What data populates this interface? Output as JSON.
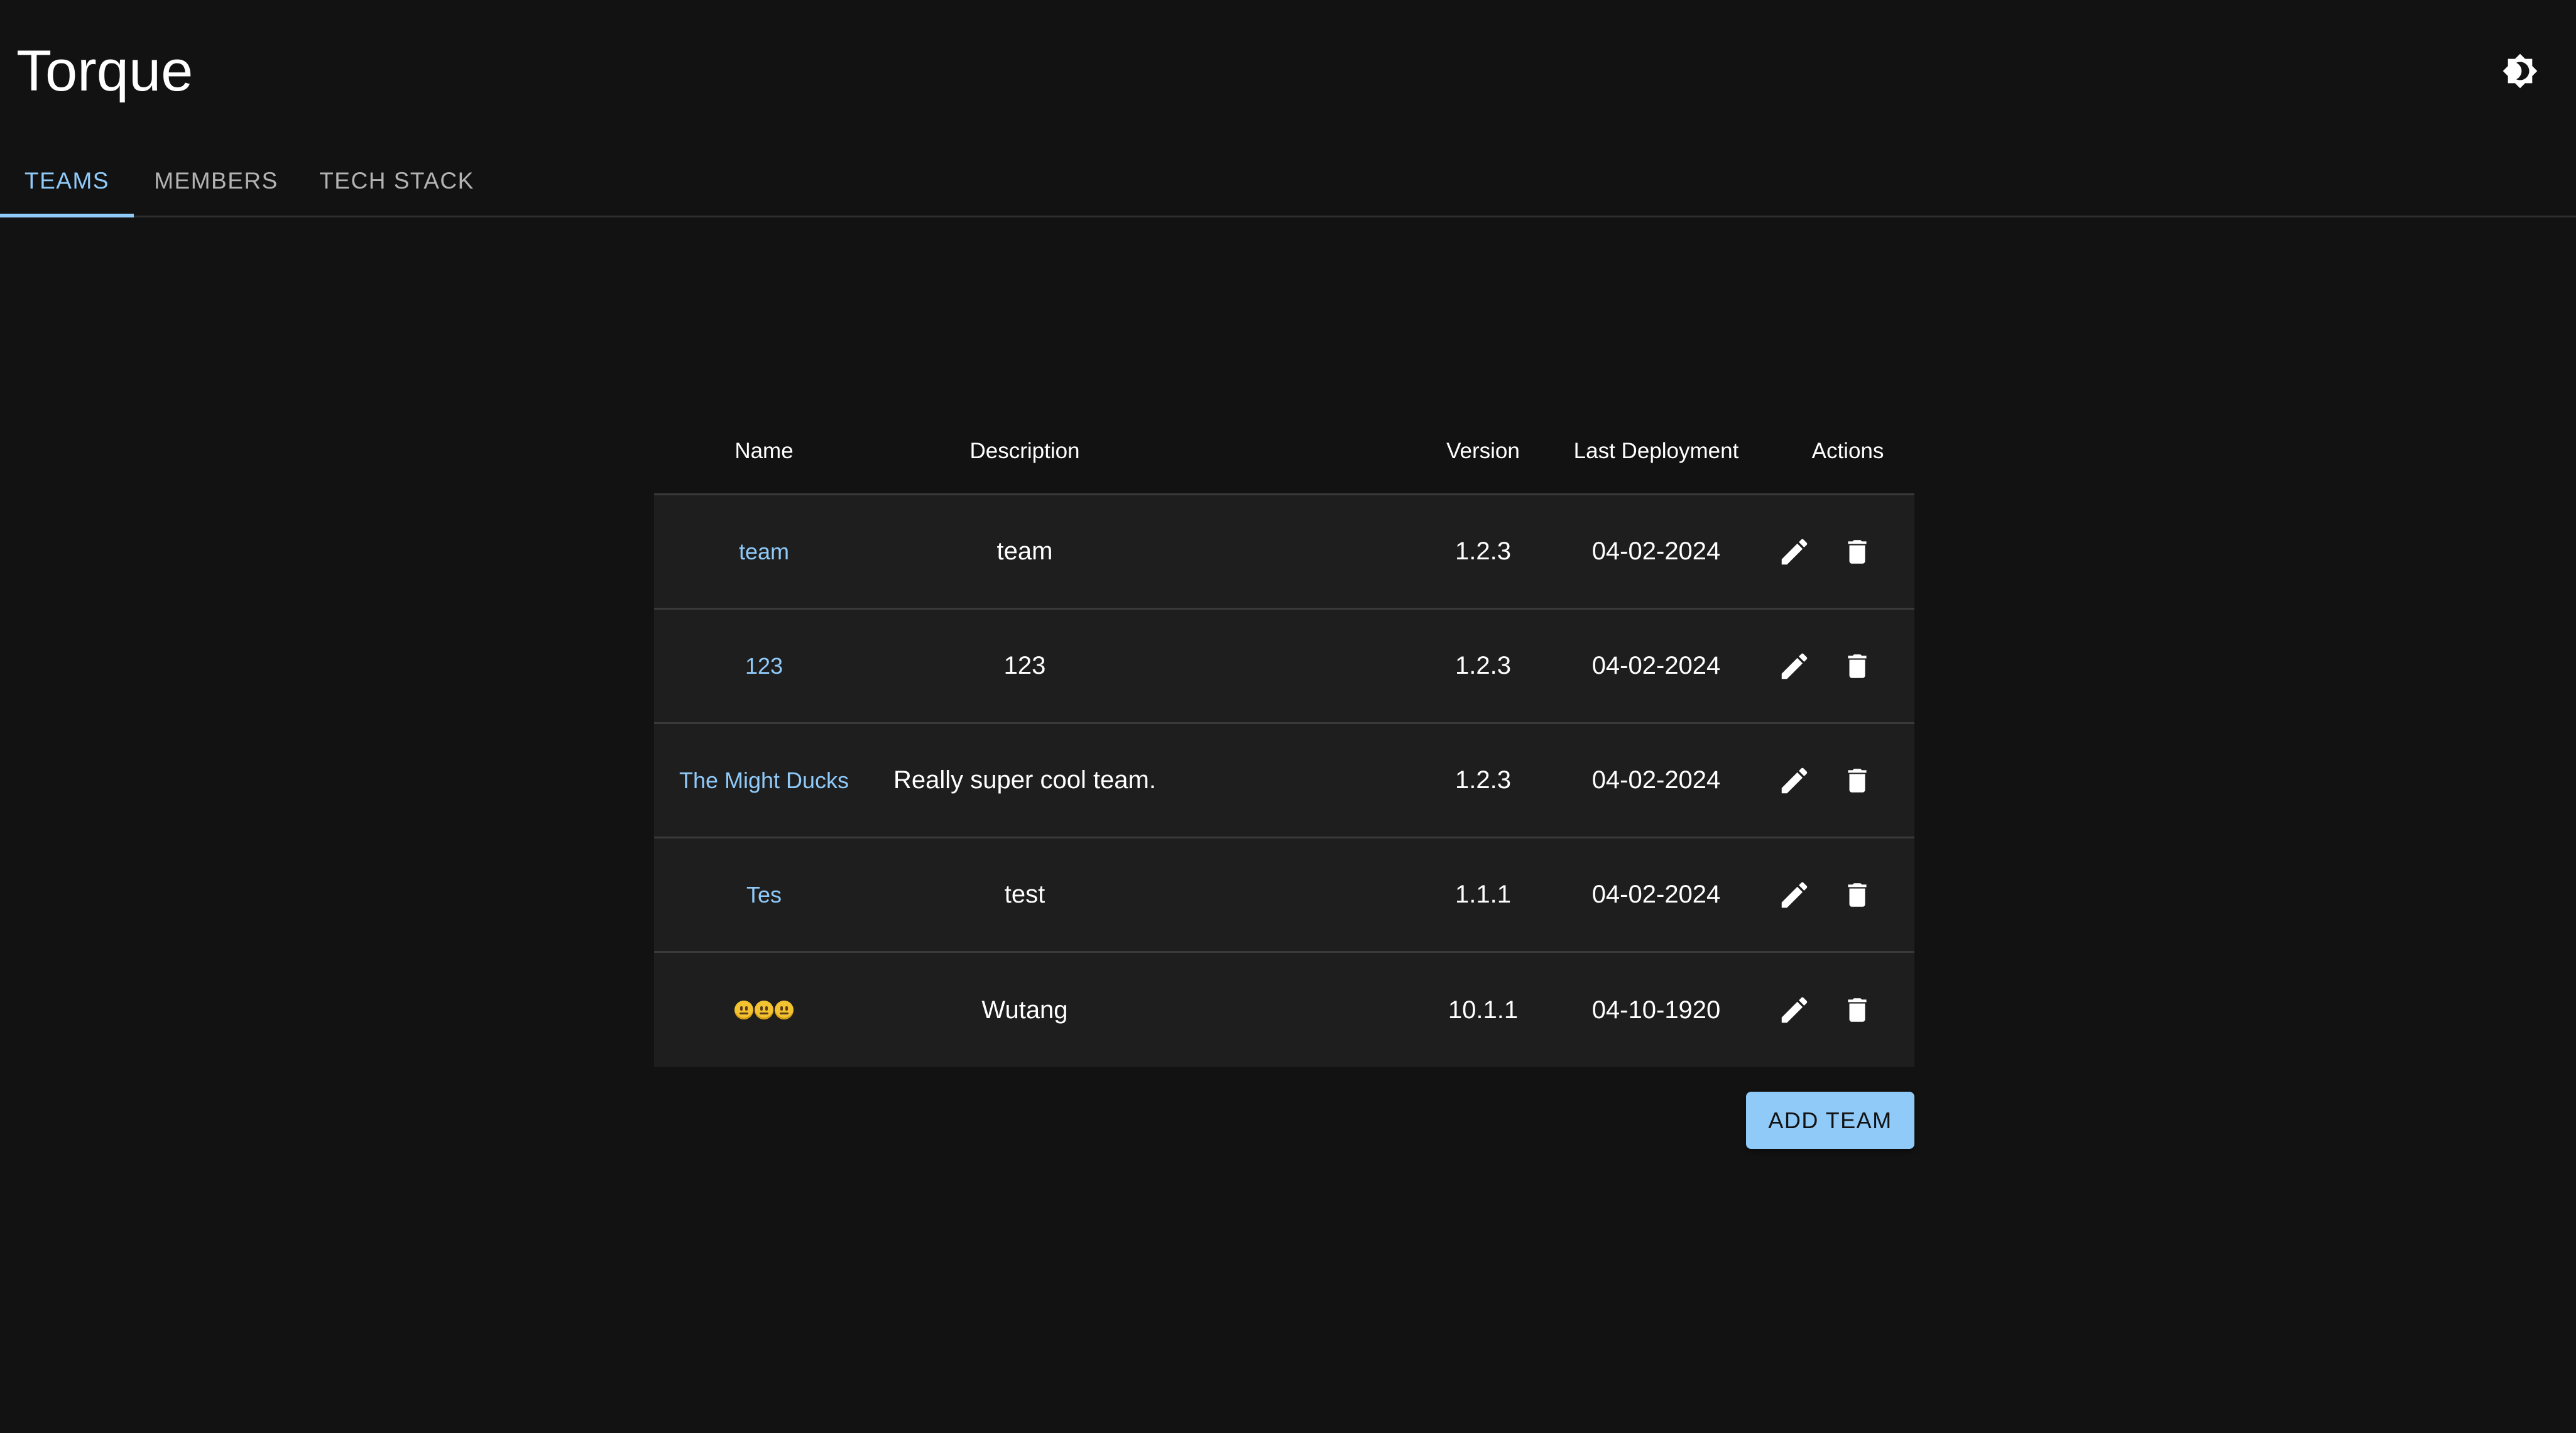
{
  "app": {
    "title": "Torque"
  },
  "header": {
    "theme_icon": "brightness-icon"
  },
  "tabs": [
    {
      "label": "TEAMS",
      "active": true
    },
    {
      "label": "MEMBERS",
      "active": false
    },
    {
      "label": "TECH STACK",
      "active": false
    }
  ],
  "table": {
    "columns": [
      "Name",
      "Description",
      "Version",
      "Last Deployment",
      "Actions"
    ],
    "rows": [
      {
        "name": "team",
        "description": "team",
        "version": "1.2.3",
        "last_deployment": "04-02-2024"
      },
      {
        "name": "123",
        "description": "123",
        "version": "1.2.3",
        "last_deployment": "04-02-2024"
      },
      {
        "name": "The Might Ducks",
        "description": "Really super cool team.",
        "version": "1.2.3",
        "last_deployment": "04-02-2024"
      },
      {
        "name": "Tes",
        "description": "test",
        "version": "1.1.1",
        "last_deployment": "04-02-2024"
      },
      {
        "name": "😐😐😐",
        "description": "Wutang",
        "version": "10.1.1",
        "last_deployment": "04-10-1920"
      }
    ],
    "action_icons": [
      "edit-icon",
      "delete-icon"
    ]
  },
  "buttons": {
    "add_team": "ADD TEAM"
  },
  "colors": {
    "background": "#121212",
    "table_body": "#1e1e1e",
    "accent": "#90caf9",
    "text": "#ffffff"
  }
}
